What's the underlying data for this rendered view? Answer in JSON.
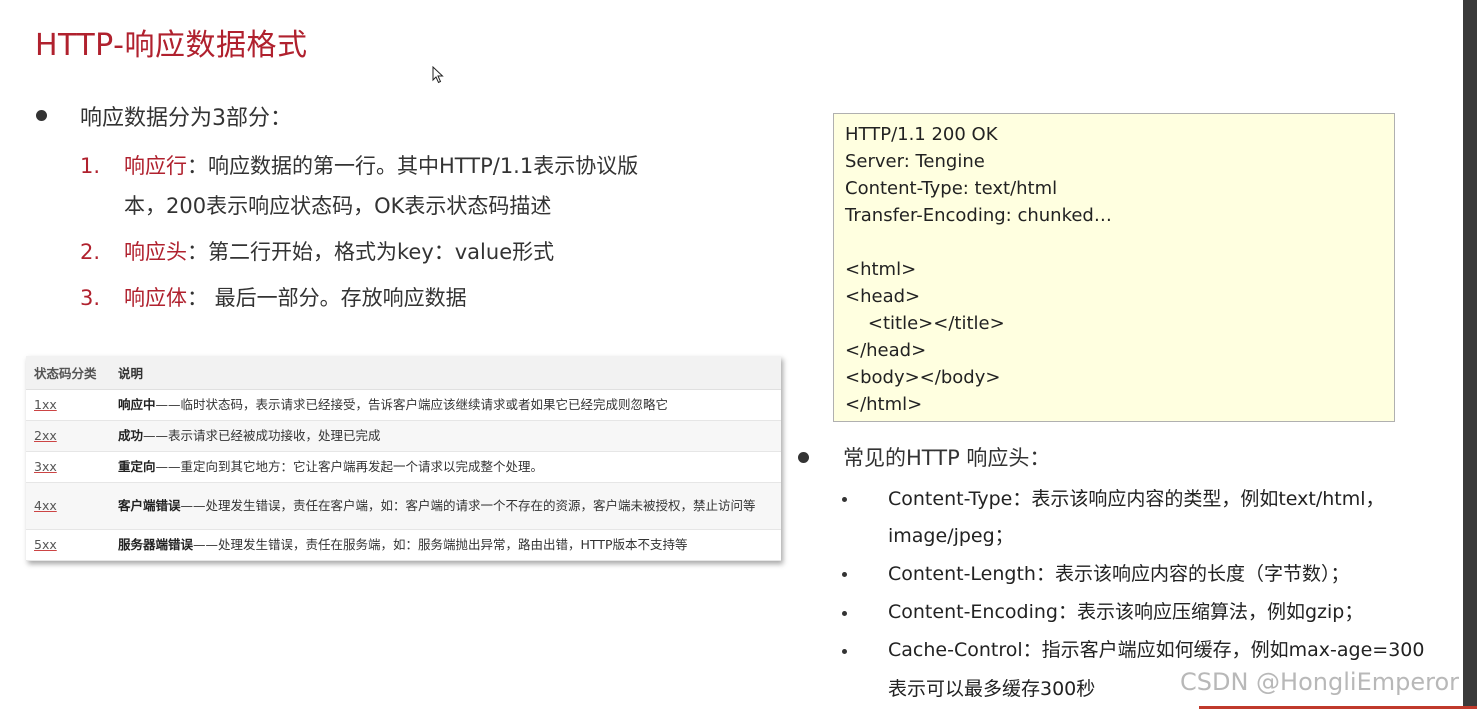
{
  "title": "HTTP-响应数据格式",
  "intro": "响应数据分为3部分：",
  "parts": [
    {
      "num": "1.",
      "key": "响应行",
      "text": "：响应数据的第一行。其中HTTP/1.1表示协议版",
      "cont": "本，200表示响应状态码，OK表示状态码描述"
    },
    {
      "num": "2.",
      "key": "响应头",
      "text": "：第二行开始，格式为key：value形式"
    },
    {
      "num": "3.",
      "key": "响应体",
      "text": "： 最后一部分。存放响应数据"
    }
  ],
  "code_lines": [
    "HTTP/1.1 200 OK",
    "Server: Tengine",
    "Content-Type: text/html",
    "Transfer-Encoding: chunked…",
    "",
    "<html>",
    "<head>",
    "    <title></title>",
    "</head>",
    "<body></body>",
    "</html>"
  ],
  "table": {
    "headers": [
      "状态码分类",
      "说明"
    ],
    "rows": [
      {
        "code": "1xx",
        "strong": "响应中",
        "desc": "——临时状态码，表示请求已经接受，告诉客户端应该继续请求或者如果它已经完成则忽略它"
      },
      {
        "code": "2xx",
        "strong": "成功",
        "desc": "——表示请求已经被成功接收，处理已完成"
      },
      {
        "code": "3xx",
        "strong": "重定向",
        "desc": "——重定向到其它地方：它让客户端再发起一个请求以完成整个处理。"
      },
      {
        "code": "4xx",
        "strong": "客户端错误",
        "desc": "——处理发生错误，责任在客户端，如：客户端的请求一个不存在的资源，客户端未被授权，禁止访问等"
      },
      {
        "code": "5xx",
        "strong": "服务器端错误",
        "desc": "——处理发生错误，责任在服务端，如：服务端抛出异常，路由出错，HTTP版本不支持等"
      }
    ]
  },
  "headers_title": "常见的HTTP 响应头：",
  "header_items": [
    {
      "text": "Content-Type：表示该响应内容的类型，例如text/html，",
      "cont": "image/jpeg；"
    },
    {
      "text": "Content-Length：表示该响应内容的长度（字节数）；"
    },
    {
      "text": "Content-Encoding：表示该响应压缩算法，例如gzip；"
    },
    {
      "text": "Cache-Control：指示客户端应如何缓存，例如max-age=300",
      "cont": "表示可以最多缓存300秒"
    }
  ],
  "watermark": "CSDN @HongliEmperor",
  "colors": {
    "accent": "#b0212e",
    "code_bg": "#ffffe0"
  }
}
